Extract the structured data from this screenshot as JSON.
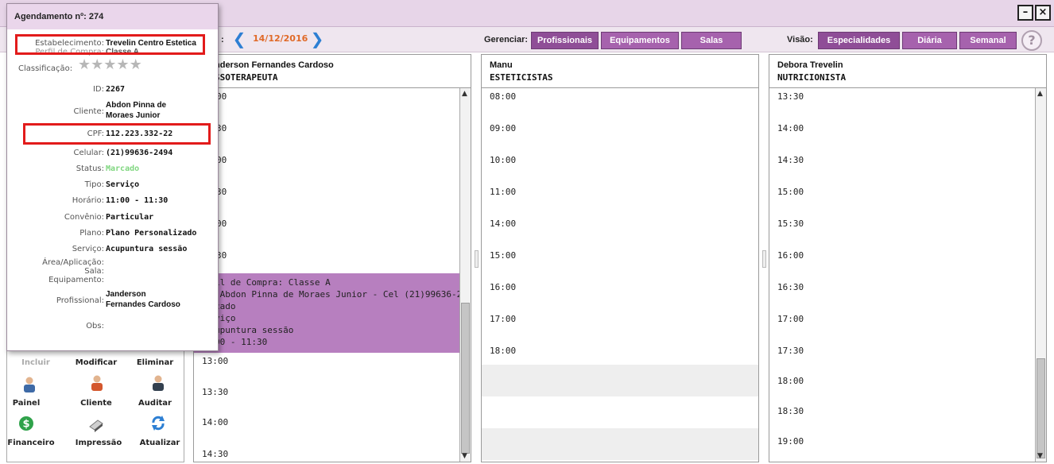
{
  "window": {
    "minimize_glyph": "–",
    "close_glyph": "×"
  },
  "toolbar": {
    "date_prefix": ":",
    "date": "14/12/2016",
    "manage_label": "Gerenciar:",
    "manage_buttons": [
      "Profissionais",
      "Equipamentos",
      "Salas"
    ],
    "view_label": "Visão:",
    "view_buttons": [
      "Especialidades",
      "Diária",
      "Semanal"
    ],
    "help_glyph": "?"
  },
  "columns": [
    {
      "name": "nderson Fernandes Cardoso",
      "specialty": "SSOTERAPEUTA",
      "slots": [
        "00",
        "30",
        "00",
        "30",
        "00",
        "30",
        "13:00",
        "13:30",
        "14:00",
        "14:30"
      ],
      "appointment": [
        "il de Compra: Classe A",
        "-Abdon Pinna de Moraes Junior - Cel (21)99636-2",
        "cado",
        "viço",
        "upuntura sessão",
        "00 - 11:30"
      ]
    },
    {
      "name": "Manu",
      "specialty": "ESTETICISTAS",
      "slots": [
        "08:00",
        "09:00",
        "10:00",
        "11:00",
        "14:00",
        "15:00",
        "16:00",
        "17:00",
        "18:00"
      ]
    },
    {
      "name": "Debora Trevelin",
      "specialty": "NUTRICIONISTA",
      "slots": [
        "13:30",
        "14:00",
        "14:30",
        "15:00",
        "15:30",
        "16:00",
        "16:30",
        "17:00",
        "17:30",
        "18:00",
        "18:30",
        "19:00"
      ]
    }
  ],
  "actions": {
    "row1": [
      "Incluir",
      "Modificar",
      "Eliminar"
    ],
    "row2": [
      "Painel",
      "Cliente",
      "Auditar"
    ],
    "row3": [
      "Financeiro",
      "Impressão",
      "Atualizar"
    ]
  },
  "popup": {
    "title": "Agendamento nº: 274",
    "fields": {
      "estabelecimento_k": "Estabelecimento:",
      "estabelecimento_v": "Trevelin Centro Estetica",
      "perfil_k": "Perfil de Compra:",
      "perfil_v": "Classe A",
      "classificacao_k": "Classificação:",
      "id_k": "ID:",
      "id_v": "2267",
      "cliente_k": "Cliente:",
      "cliente_v1": "Abdon Pinna de",
      "cliente_v2": "Moraes Junior",
      "cpf_k": "CPF:",
      "cpf_v": "112.223.332-22",
      "celular_k": "Celular:",
      "celular_v": "(21)99636-2494",
      "status_k": "Status:",
      "status_v": "Marcado",
      "tipo_k": "Tipo:",
      "tipo_v": "Serviço",
      "horario_k": "Horário:",
      "horario_v": "11:00 - 11:30",
      "convenio_k": "Convênio:",
      "convenio_v": "Particular",
      "plano_k": "Plano:",
      "plano_v": "Plano Personalizado",
      "servico_k": "Serviço:",
      "servico_v": "Acupuntura sessão",
      "area_k": "Área/Aplicação:",
      "sala_k": "Sala:",
      "equipamento_k": "Equipamento:",
      "profissional_k": "Profissional:",
      "profissional_v1": "Janderson",
      "profissional_v2": "Fernandes Cardoso",
      "obs_k": "Obs:"
    },
    "stars": 5,
    "status_color": "#7fd67f"
  }
}
